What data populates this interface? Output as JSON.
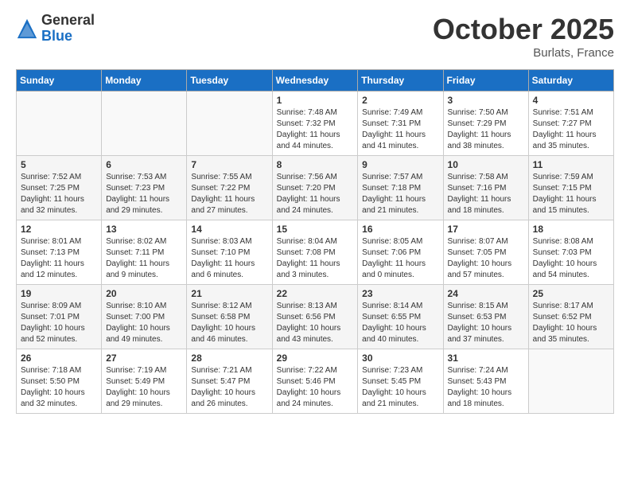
{
  "logo": {
    "general": "General",
    "blue": "Blue"
  },
  "header": {
    "month": "October 2025",
    "location": "Burlats, France"
  },
  "weekdays": [
    "Sunday",
    "Monday",
    "Tuesday",
    "Wednesday",
    "Thursday",
    "Friday",
    "Saturday"
  ],
  "weeks": [
    [
      {
        "day": "",
        "info": ""
      },
      {
        "day": "",
        "info": ""
      },
      {
        "day": "",
        "info": ""
      },
      {
        "day": "1",
        "info": "Sunrise: 7:48 AM\nSunset: 7:32 PM\nDaylight: 11 hours\nand 44 minutes."
      },
      {
        "day": "2",
        "info": "Sunrise: 7:49 AM\nSunset: 7:31 PM\nDaylight: 11 hours\nand 41 minutes."
      },
      {
        "day": "3",
        "info": "Sunrise: 7:50 AM\nSunset: 7:29 PM\nDaylight: 11 hours\nand 38 minutes."
      },
      {
        "day": "4",
        "info": "Sunrise: 7:51 AM\nSunset: 7:27 PM\nDaylight: 11 hours\nand 35 minutes."
      }
    ],
    [
      {
        "day": "5",
        "info": "Sunrise: 7:52 AM\nSunset: 7:25 PM\nDaylight: 11 hours\nand 32 minutes."
      },
      {
        "day": "6",
        "info": "Sunrise: 7:53 AM\nSunset: 7:23 PM\nDaylight: 11 hours\nand 29 minutes."
      },
      {
        "day": "7",
        "info": "Sunrise: 7:55 AM\nSunset: 7:22 PM\nDaylight: 11 hours\nand 27 minutes."
      },
      {
        "day": "8",
        "info": "Sunrise: 7:56 AM\nSunset: 7:20 PM\nDaylight: 11 hours\nand 24 minutes."
      },
      {
        "day": "9",
        "info": "Sunrise: 7:57 AM\nSunset: 7:18 PM\nDaylight: 11 hours\nand 21 minutes."
      },
      {
        "day": "10",
        "info": "Sunrise: 7:58 AM\nSunset: 7:16 PM\nDaylight: 11 hours\nand 18 minutes."
      },
      {
        "day": "11",
        "info": "Sunrise: 7:59 AM\nSunset: 7:15 PM\nDaylight: 11 hours\nand 15 minutes."
      }
    ],
    [
      {
        "day": "12",
        "info": "Sunrise: 8:01 AM\nSunset: 7:13 PM\nDaylight: 11 hours\nand 12 minutes."
      },
      {
        "day": "13",
        "info": "Sunrise: 8:02 AM\nSunset: 7:11 PM\nDaylight: 11 hours\nand 9 minutes."
      },
      {
        "day": "14",
        "info": "Sunrise: 8:03 AM\nSunset: 7:10 PM\nDaylight: 11 hours\nand 6 minutes."
      },
      {
        "day": "15",
        "info": "Sunrise: 8:04 AM\nSunset: 7:08 PM\nDaylight: 11 hours\nand 3 minutes."
      },
      {
        "day": "16",
        "info": "Sunrise: 8:05 AM\nSunset: 7:06 PM\nDaylight: 11 hours\nand 0 minutes."
      },
      {
        "day": "17",
        "info": "Sunrise: 8:07 AM\nSunset: 7:05 PM\nDaylight: 10 hours\nand 57 minutes."
      },
      {
        "day": "18",
        "info": "Sunrise: 8:08 AM\nSunset: 7:03 PM\nDaylight: 10 hours\nand 54 minutes."
      }
    ],
    [
      {
        "day": "19",
        "info": "Sunrise: 8:09 AM\nSunset: 7:01 PM\nDaylight: 10 hours\nand 52 minutes."
      },
      {
        "day": "20",
        "info": "Sunrise: 8:10 AM\nSunset: 7:00 PM\nDaylight: 10 hours\nand 49 minutes."
      },
      {
        "day": "21",
        "info": "Sunrise: 8:12 AM\nSunset: 6:58 PM\nDaylight: 10 hours\nand 46 minutes."
      },
      {
        "day": "22",
        "info": "Sunrise: 8:13 AM\nSunset: 6:56 PM\nDaylight: 10 hours\nand 43 minutes."
      },
      {
        "day": "23",
        "info": "Sunrise: 8:14 AM\nSunset: 6:55 PM\nDaylight: 10 hours\nand 40 minutes."
      },
      {
        "day": "24",
        "info": "Sunrise: 8:15 AM\nSunset: 6:53 PM\nDaylight: 10 hours\nand 37 minutes."
      },
      {
        "day": "25",
        "info": "Sunrise: 8:17 AM\nSunset: 6:52 PM\nDaylight: 10 hours\nand 35 minutes."
      }
    ],
    [
      {
        "day": "26",
        "info": "Sunrise: 7:18 AM\nSunset: 5:50 PM\nDaylight: 10 hours\nand 32 minutes."
      },
      {
        "day": "27",
        "info": "Sunrise: 7:19 AM\nSunset: 5:49 PM\nDaylight: 10 hours\nand 29 minutes."
      },
      {
        "day": "28",
        "info": "Sunrise: 7:21 AM\nSunset: 5:47 PM\nDaylight: 10 hours\nand 26 minutes."
      },
      {
        "day": "29",
        "info": "Sunrise: 7:22 AM\nSunset: 5:46 PM\nDaylight: 10 hours\nand 24 minutes."
      },
      {
        "day": "30",
        "info": "Sunrise: 7:23 AM\nSunset: 5:45 PM\nDaylight: 10 hours\nand 21 minutes."
      },
      {
        "day": "31",
        "info": "Sunrise: 7:24 AM\nSunset: 5:43 PM\nDaylight: 10 hours\nand 18 minutes."
      },
      {
        "day": "",
        "info": ""
      }
    ]
  ]
}
